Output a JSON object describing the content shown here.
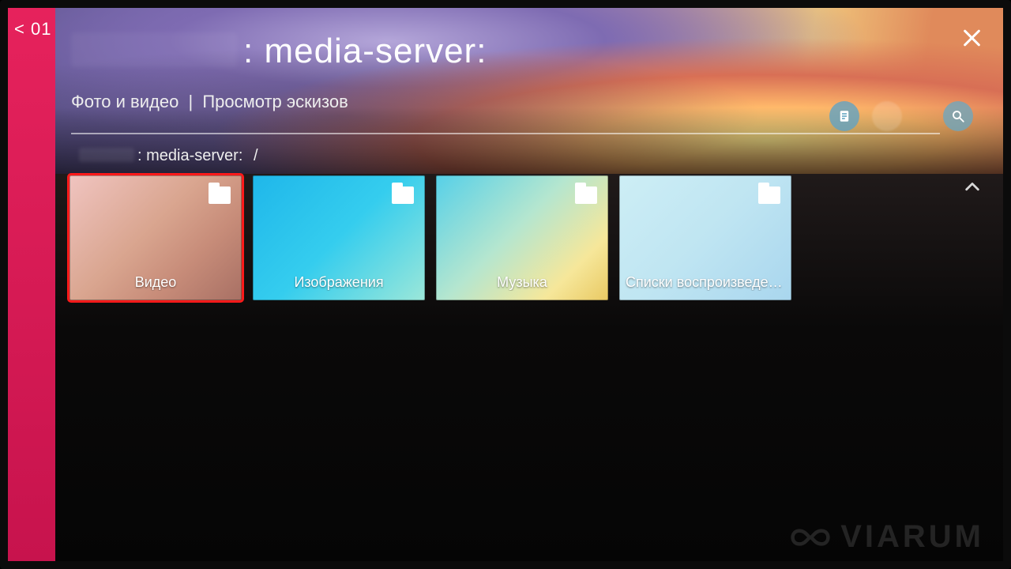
{
  "header": {
    "back_label": "< 01",
    "title_suffix": ": media-server:",
    "subtitle_left": "Фото и видео",
    "subtitle_sep": "|",
    "subtitle_right": "Просмотр эскизов"
  },
  "actions": {
    "doc_icon": "document-icon",
    "search_icon": "search-icon",
    "close_icon": "close-icon"
  },
  "breadcrumb": {
    "suffix": ": media-server:",
    "separator": "/"
  },
  "folders": [
    {
      "label": "Видео",
      "selected": true
    },
    {
      "label": "Изображения",
      "selected": false
    },
    {
      "label": "Музыка",
      "selected": false
    },
    {
      "label": "Списки воспроизведения",
      "selected": false
    }
  ],
  "watermark": {
    "text": "VIARUM"
  },
  "colors": {
    "accent": "#e6225c",
    "selection": "#ff1a1a"
  }
}
